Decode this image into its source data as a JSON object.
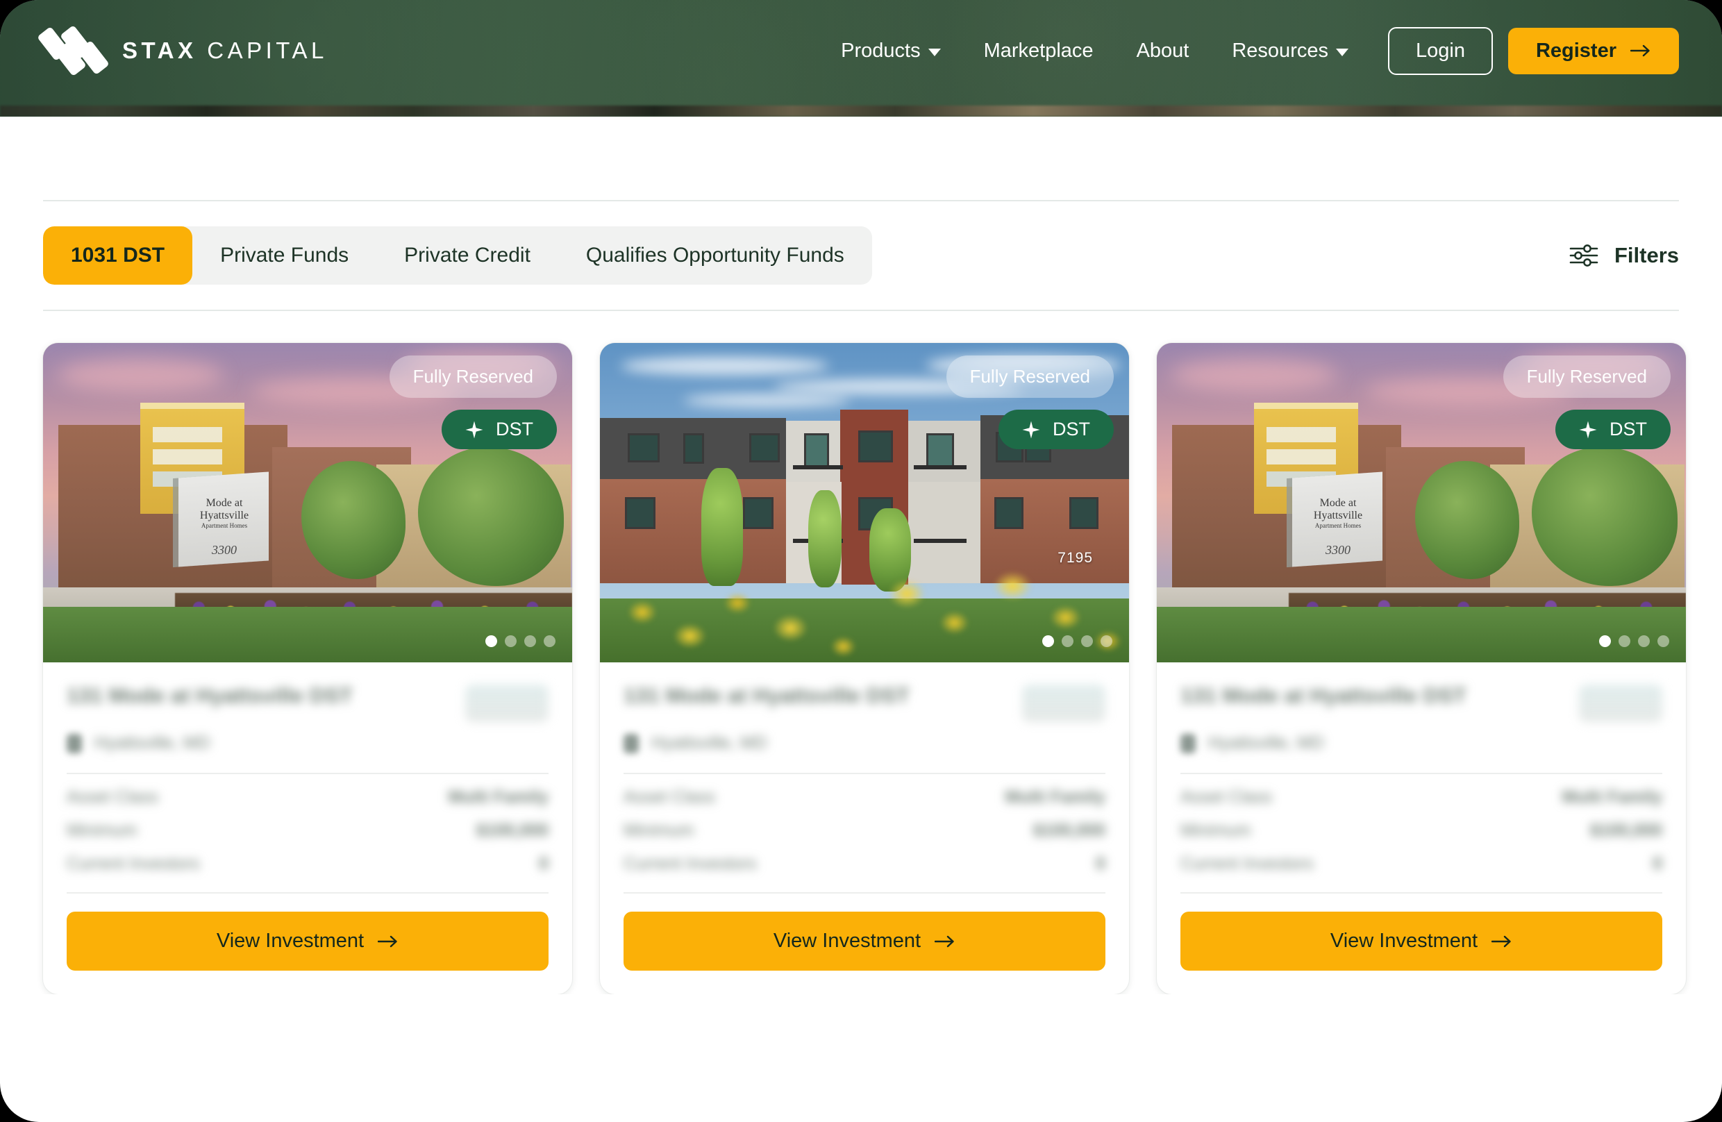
{
  "brand": {
    "logo_icon": "stax-stack-logo-icon",
    "name_bold": "STAX",
    "name_light": "CAPITAL"
  },
  "header": {
    "nav_items": [
      {
        "label": "Products",
        "has_caret": true,
        "icon": "chevron-down-icon"
      },
      {
        "label": "Marketplace",
        "has_caret": false
      },
      {
        "label": "About",
        "has_caret": false
      },
      {
        "label": "Resources",
        "has_caret": true,
        "icon": "chevron-down-icon"
      }
    ],
    "login_label": "Login",
    "register_label": "Register",
    "register_icon": "arrow-right-icon",
    "background_color": "#2d4a38",
    "accent_color": "#fbb007"
  },
  "toolbar": {
    "tabs": [
      {
        "label": "1031 DST",
        "active": true
      },
      {
        "label": "Private Funds",
        "active": false
      },
      {
        "label": "Private Credit",
        "active": false
      },
      {
        "label": "Qualifies Opportunity Funds",
        "active": false
      }
    ],
    "filters_label": "Filters",
    "filters_icon": "sliders-icon",
    "active_tab_color": "#fbb007",
    "tab_group_bg": "#f1f2f1"
  },
  "cards": [
    {
      "photo": "mode-at-hyattsville-sunset",
      "photo_sign_line1": "Mode at",
      "photo_sign_line2": "Hyattsville",
      "photo_sign_line3": "Apartment Homes",
      "photo_sign_number": "3300",
      "status_badge": "Fully Reserved",
      "type_badge": "DST",
      "type_badge_icon": "sparkle-icon",
      "type_badge_color": "#1d6b47",
      "carousel_dots": 4,
      "carousel_active": 0,
      "title": "131 Mode at Hyattsville DST",
      "location": "Hyattsville, MD",
      "location_icon": "map-pin-icon",
      "stats": [
        {
          "label": "Asset Class",
          "value": "Multi Family"
        },
        {
          "label": "Minimum",
          "value": "$100,000"
        },
        {
          "label": "Current Investors",
          "value": "0"
        }
      ],
      "cta_label": "View Investment",
      "cta_icon": "arrow-right-icon",
      "content_redacted": true
    },
    {
      "photo": "modern-apartments-yellow-flowers",
      "photo_address": "7195",
      "status_badge": "Fully Reserved",
      "type_badge": "DST",
      "type_badge_icon": "sparkle-icon",
      "type_badge_color": "#1d6b47",
      "carousel_dots": 4,
      "carousel_active": 0,
      "title": "131 Mode at Hyattsville DST",
      "location": "Hyattsville, MD",
      "location_icon": "map-pin-icon",
      "stats": [
        {
          "label": "Asset Class",
          "value": "Multi Family"
        },
        {
          "label": "Minimum",
          "value": "$100,000"
        },
        {
          "label": "Current Investors",
          "value": "0"
        }
      ],
      "cta_label": "View Investment",
      "cta_icon": "arrow-right-icon",
      "content_redacted": true
    },
    {
      "photo": "mode-at-hyattsville-sunset",
      "photo_sign_line1": "Mode at",
      "photo_sign_line2": "Hyattsville",
      "photo_sign_line3": "Apartment Homes",
      "photo_sign_number": "3300",
      "status_badge": "Fully Reserved",
      "type_badge": "DST",
      "type_badge_icon": "sparkle-icon",
      "type_badge_color": "#1d6b47",
      "carousel_dots": 4,
      "carousel_active": 0,
      "title": "131 Mode at Hyattsville DST",
      "location": "Hyattsville, MD",
      "location_icon": "map-pin-icon",
      "stats": [
        {
          "label": "Asset Class",
          "value": "Multi Family"
        },
        {
          "label": "Minimum",
          "value": "$100,000"
        },
        {
          "label": "Current Investors",
          "value": "0"
        }
      ],
      "cta_label": "View Investment",
      "cta_icon": "arrow-right-icon",
      "content_redacted": true
    }
  ]
}
